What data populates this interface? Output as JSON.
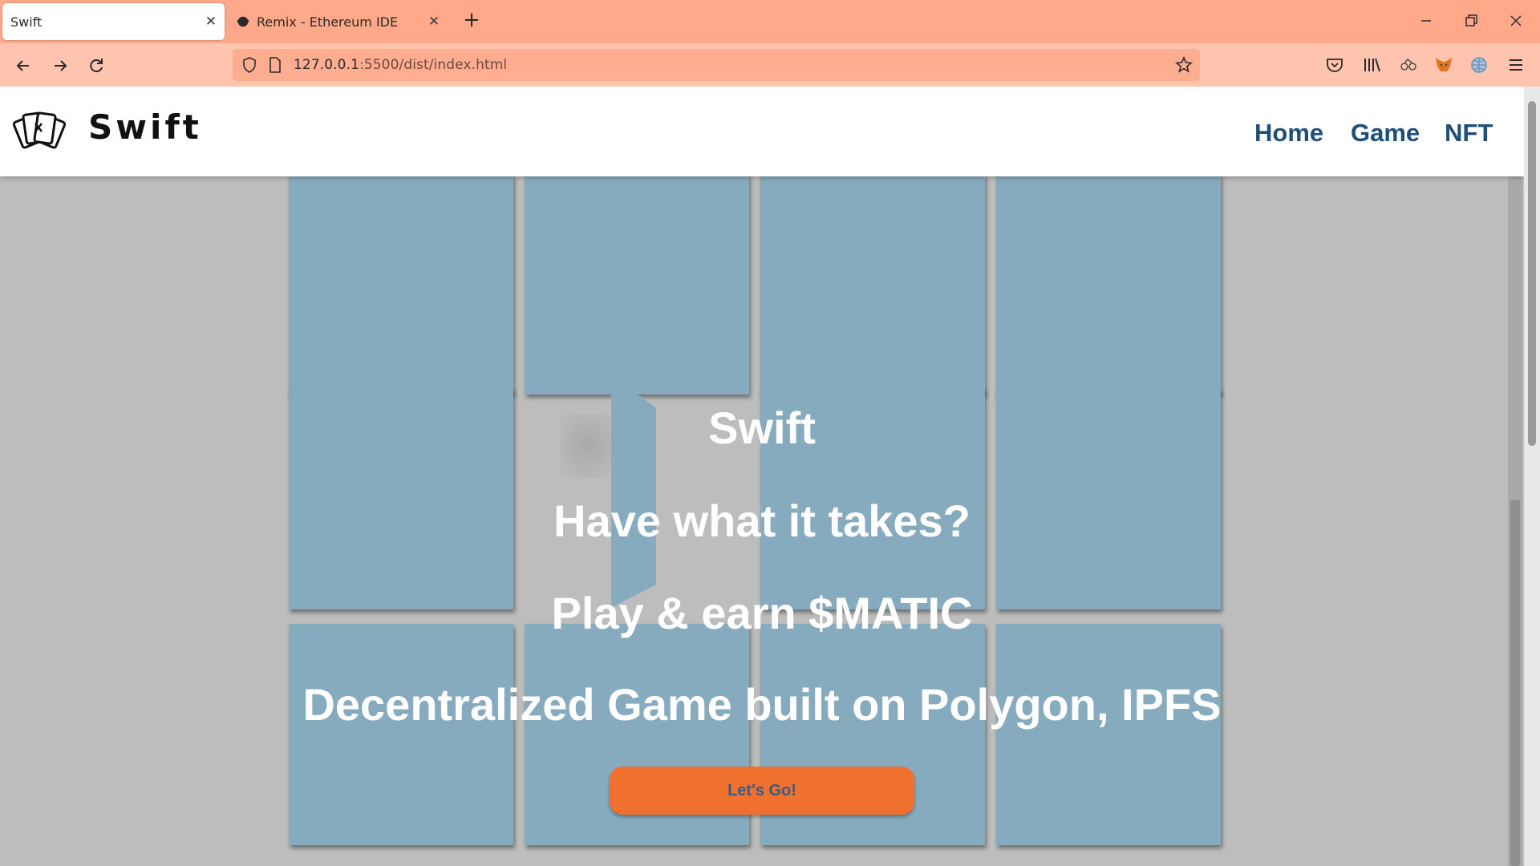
{
  "browser": {
    "tabs": [
      {
        "title": "Swift",
        "active": true
      },
      {
        "title": "Remix - Ethereum IDE",
        "active": false
      }
    ],
    "url": {
      "host": "127.0.0.1",
      "path": ":5500/dist/index.html"
    },
    "icons": [
      "back-icon",
      "forward-icon",
      "reload-icon",
      "shield-icon",
      "page-icon",
      "bookmark-star-icon",
      "pocket-icon",
      "library-icon",
      "extension-icon",
      "metamask-icon",
      "globe-icon",
      "menu-icon"
    ]
  },
  "site": {
    "brand": "Swift",
    "nav": {
      "home": "Home",
      "game": "Game",
      "nft": "NFT"
    }
  },
  "hero": {
    "title": "Swift",
    "line1": "Have what it takes?",
    "line2": "Play & earn $MATIC",
    "line3": "Decentralized Game built on Polygon, IPFS",
    "cta": "Let's Go!"
  },
  "colors": {
    "tabbar": "#ffa88a",
    "navbar": "#ffc4ad",
    "card": "#87abbe",
    "cta": "#f07030",
    "nav_link": "#1f4e79"
  }
}
